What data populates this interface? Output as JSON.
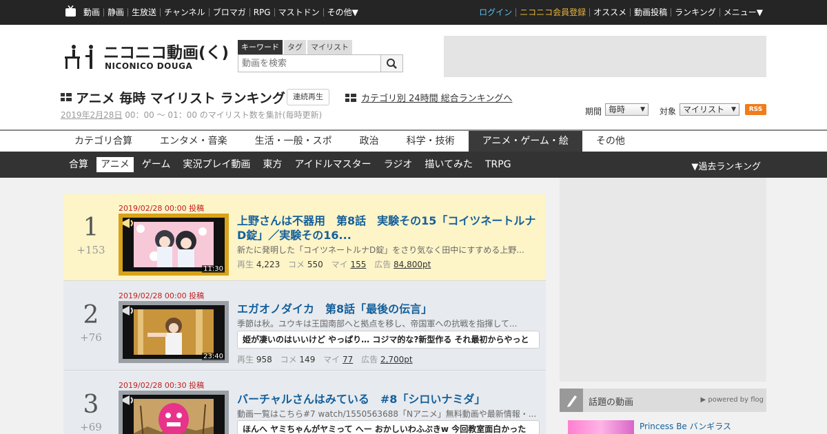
{
  "topbar": {
    "left_links": [
      "動画",
      "静画",
      "生放送",
      "チャンネル",
      "ブロマガ",
      "RPG",
      "マストドン",
      "その他▼"
    ],
    "right_links": [
      "ログイン",
      "ニコニコ会員登録",
      "オススメ",
      "動画投稿",
      "ランキング",
      "メニュー▼"
    ]
  },
  "search": {
    "tabs": [
      "キーワード",
      "タグ",
      "マイリスト"
    ],
    "placeholder": "動画を検索"
  },
  "title": {
    "text": "アニメ 毎時 マイリスト ランキング",
    "continuous_button": "連続再生",
    "category_link": "カテゴリ別 24時間 総合ランキングへ",
    "subtitle_date": "2019年2月28日",
    "subtitle_rest": " 00：00 ～ 01：00 のマイリスト数を集計(毎時更新)"
  },
  "filters": {
    "period_label": "期間",
    "period_value": "毎時",
    "target_label": "対象",
    "target_value": "マイリスト",
    "rss": "RSS"
  },
  "category_tabs": [
    "カテゴリ合算",
    "エンタメ・音楽",
    "生活・一般・スポ",
    "政治",
    "科学・技術",
    "アニメ・ゲーム・絵",
    "その他"
  ],
  "category_active": 5,
  "sub_tabs": [
    "合算",
    "アニメ",
    "ゲーム",
    "実況プレイ動画",
    "東方",
    "アイドルマスター",
    "ラジオ",
    "描いてみた",
    "TRPG"
  ],
  "sub_active": 1,
  "past_ranking": "▼過去ランキング",
  "stat_labels": {
    "views": "再生",
    "comments": "コメ",
    "mylist": "マイ",
    "ads": "広告"
  },
  "items": [
    {
      "rank": "1",
      "delta": "+153",
      "date": "2019/02/28 00:00 投稿",
      "title": "上野さんは不器用　第8話　実験その15「コイツネートルナD錠」／実験その16...",
      "desc": "新たに発明した「コイツネートルナD錠」をさり気なく田中にすすめる上野...",
      "comment": "",
      "length": "11:30",
      "views": "4,223",
      "comments": "550",
      "mylist": "155",
      "ads": "84,800pt"
    },
    {
      "rank": "2",
      "delta": "+76",
      "date": "2019/02/28 00:00 投稿",
      "title": "エガオノダイカ　第8話「最後の伝言」",
      "desc": "季節は秋。ユウキは王国南部へと拠点を移し、帝国軍への抗戦を指揮して...",
      "comment": "姫が凄いのはいいけど やっぱり… コジマ的な?新型作る それ最初からやっと",
      "length": "23:40",
      "views": "958",
      "comments": "149",
      "mylist": "77",
      "ads": "2,700pt"
    },
    {
      "rank": "3",
      "delta": "+69",
      "date": "2019/02/28 00:30 投稿",
      "title": "バーチャルさんはみている　#8「シロいナミダ」",
      "desc": "動画一覧はこちら#7 watch/1550563688「Nアニメ」無料動画や最新情報・...",
      "comment": "ほんへ ヤミちゃんがヤミって へー おかしいわふぶきw 今回教室面白かった",
      "length": "",
      "views": "",
      "comments": "",
      "mylist": "",
      "ads": ""
    }
  ],
  "sidebar": {
    "topic_label": "話題の動画",
    "powered": "▶ powered by flog",
    "topic_item": "Princess Be バンギラス"
  }
}
